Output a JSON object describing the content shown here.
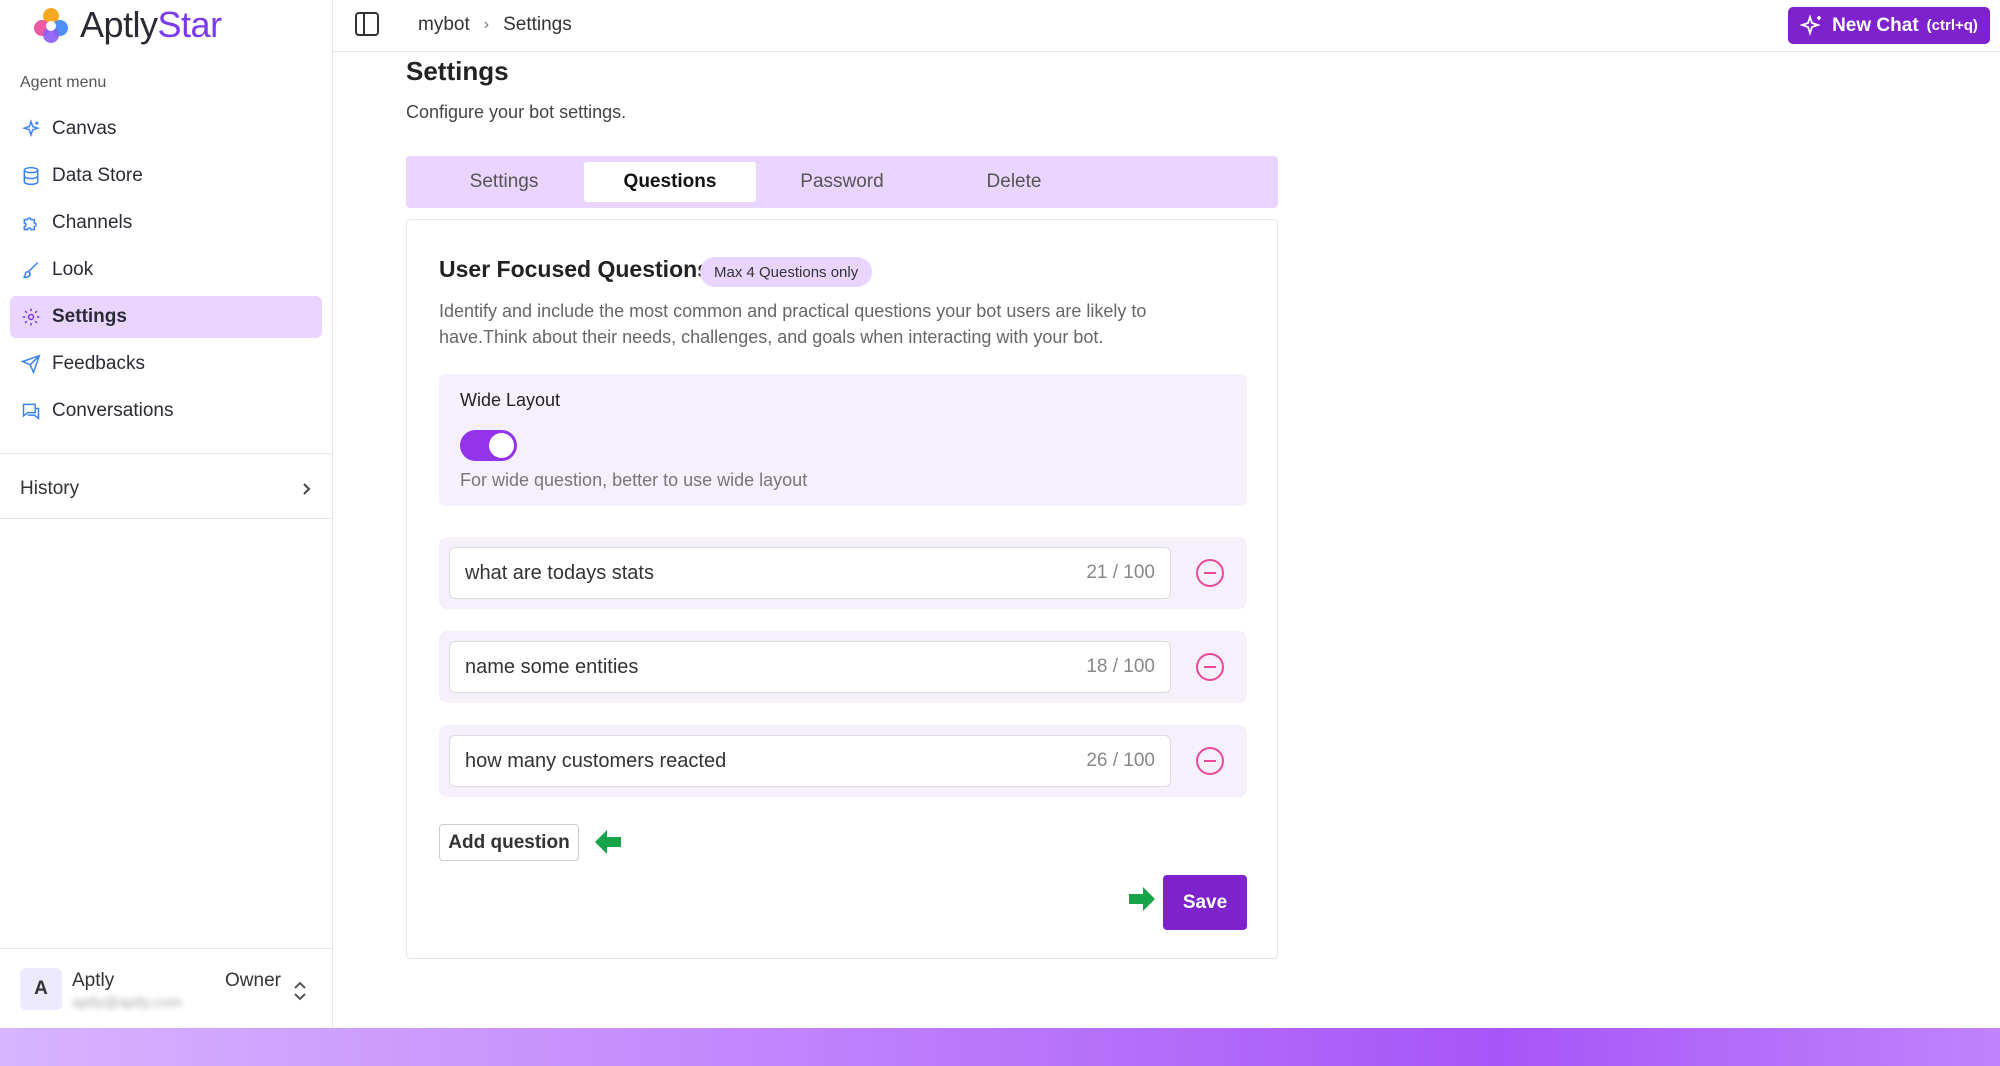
{
  "app": {
    "logo_main": "Aptly",
    "logo_accent": "Star"
  },
  "sidebar": {
    "section_label": "Agent menu",
    "items": [
      {
        "label": "Canvas",
        "icon": "sparkles-icon"
      },
      {
        "label": "Data Store",
        "icon": "database-icon"
      },
      {
        "label": "Channels",
        "icon": "puzzle-icon"
      },
      {
        "label": "Look",
        "icon": "brush-icon"
      },
      {
        "label": "Settings",
        "icon": "gear-icon",
        "active": true
      },
      {
        "label": "Feedbacks",
        "icon": "send-icon"
      },
      {
        "label": "Conversations",
        "icon": "chat-icon"
      }
    ],
    "history_label": "History",
    "user": {
      "initial": "A",
      "name": "Aptly",
      "email": "aptly@aptly.com",
      "role": "Owner"
    }
  },
  "topbar": {
    "breadcrumb": [
      "mybot",
      "Settings"
    ],
    "new_chat_label": "New Chat",
    "new_chat_shortcut": "(ctrl+q)"
  },
  "main": {
    "title": "Settings",
    "subtitle": "Configure your bot settings.",
    "tabs": [
      {
        "label": "Settings",
        "active": false
      },
      {
        "label": "Questions",
        "active": true
      },
      {
        "label": "Password",
        "active": false
      },
      {
        "label": "Delete",
        "active": false
      }
    ],
    "card": {
      "title": "User Focused Questions",
      "badge": "Max 4 Questions only",
      "description": "Identify and include the most common and practical questions your bot users are likely to have.Think about their needs, challenges, and goals when interacting with your bot.",
      "wide_layout": {
        "label": "Wide Layout",
        "enabled": true,
        "hint": "For wide question, better to use wide layout"
      },
      "questions": [
        {
          "text": "what are todays stats",
          "count": "21 / 100"
        },
        {
          "text": "name some entities",
          "count": "18 / 100"
        },
        {
          "text": "how many customers reacted",
          "count": "26 / 100"
        }
      ],
      "add_question_label": "Add question",
      "save_label": "Save"
    }
  },
  "colors": {
    "accent": "#7e22ce",
    "tab_bg": "#e9d5ff",
    "highlight_arrow": "#16a34a",
    "remove_icon": "#ec4899"
  }
}
